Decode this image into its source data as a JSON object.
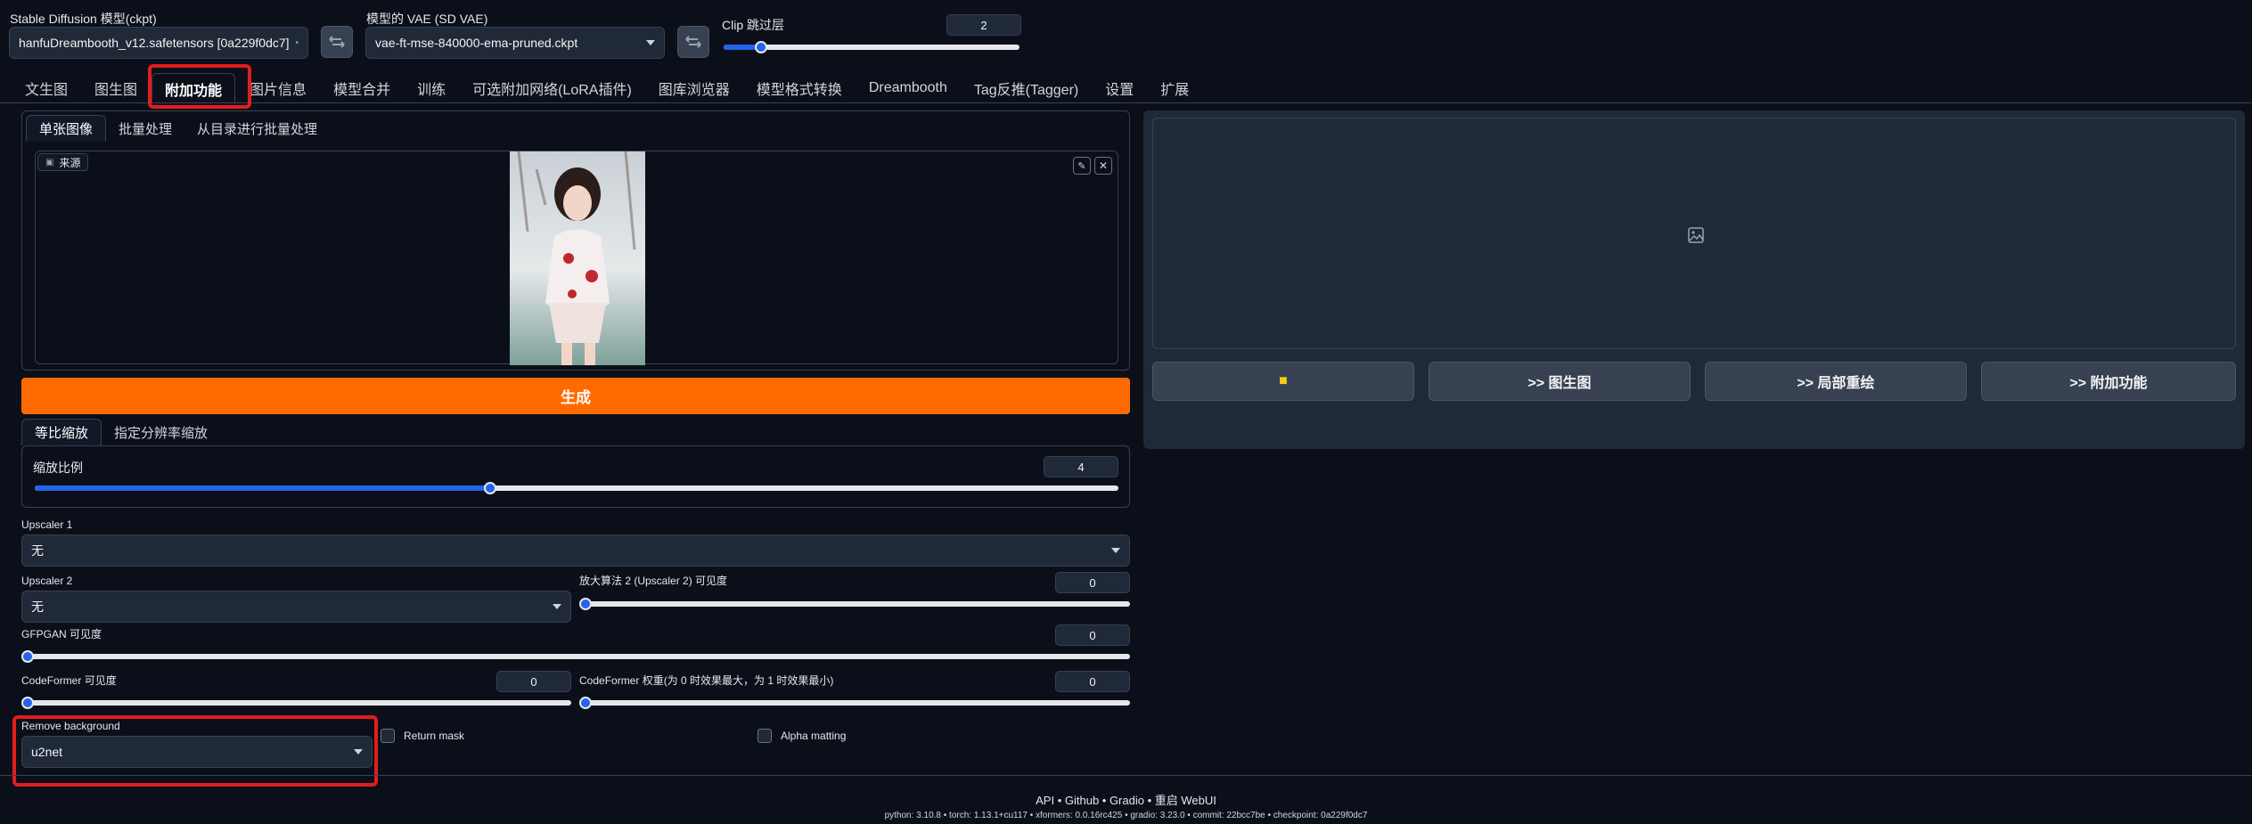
{
  "top": {
    "ckpt_label": "Stable Diffusion 模型(ckpt)",
    "ckpt_value": "hanfuDreambooth_v12.safetensors [0a229f0dc7]",
    "vae_label": "模型的 VAE (SD VAE)",
    "vae_value": "vae-ft-mse-840000-ema-pruned.ckpt",
    "clip_label": "Clip 跳过层",
    "clip_value": "2",
    "clip_level": 0.125
  },
  "tabs": [
    "文生图",
    "图生图",
    "附加功能",
    "图片信息",
    "模型合并",
    "训练",
    "可选附加网络(LoRA插件)",
    "图库浏览器",
    "模型格式转换",
    "Dreambooth",
    "Tag反推(Tagger)",
    "设置",
    "扩展"
  ],
  "subtabs": [
    "单张图像",
    "批量处理",
    "从目录进行批量处理"
  ],
  "source_label": "来源",
  "generate_label": "生成",
  "resize_tabs": [
    "等比缩放",
    "指定分辨率缩放"
  ],
  "scale": {
    "label": "缩放比例",
    "value": "4",
    "level": 0.42
  },
  "upscaler1": {
    "label": "Upscaler 1",
    "value": "无"
  },
  "upscaler2": {
    "label": "Upscaler 2",
    "value": "无"
  },
  "upscaler2_vis": {
    "label": "放大算法 2 (Upscaler 2) 可见度",
    "value": "0"
  },
  "gfpgan": {
    "label": "GFPGAN 可见度",
    "value": "0"
  },
  "codeformer": {
    "label": "CodeFormer 可见度",
    "value": "0"
  },
  "codeformer_w": {
    "label": "CodeFormer 权重(为 0 时效果最大，为 1 时效果最小)",
    "value": "0"
  },
  "rembg": {
    "label": "Remove background",
    "value": "u2net",
    "return_mask": "Return mask",
    "alpha_matting": "Alpha matting"
  },
  "output_buttons": [
    "",
    ">> 图生图",
    ">> 局部重绘",
    ">> 附加功能"
  ],
  "footer": {
    "links": "API  •  Github  •  Gradio  •  重启 WebUI",
    "versions": "python: 3.10.8  •  torch: 1.13.1+cu117  •  xformers: 0.0.16rc425  •  gradio: 3.23.0  •  commit: 22bcc7be  •  checkpoint: 0a229f0dc7"
  },
  "colors": {
    "accent": "#2563eb",
    "generate": "#ff6a00",
    "highlight": "#e11d1d"
  }
}
